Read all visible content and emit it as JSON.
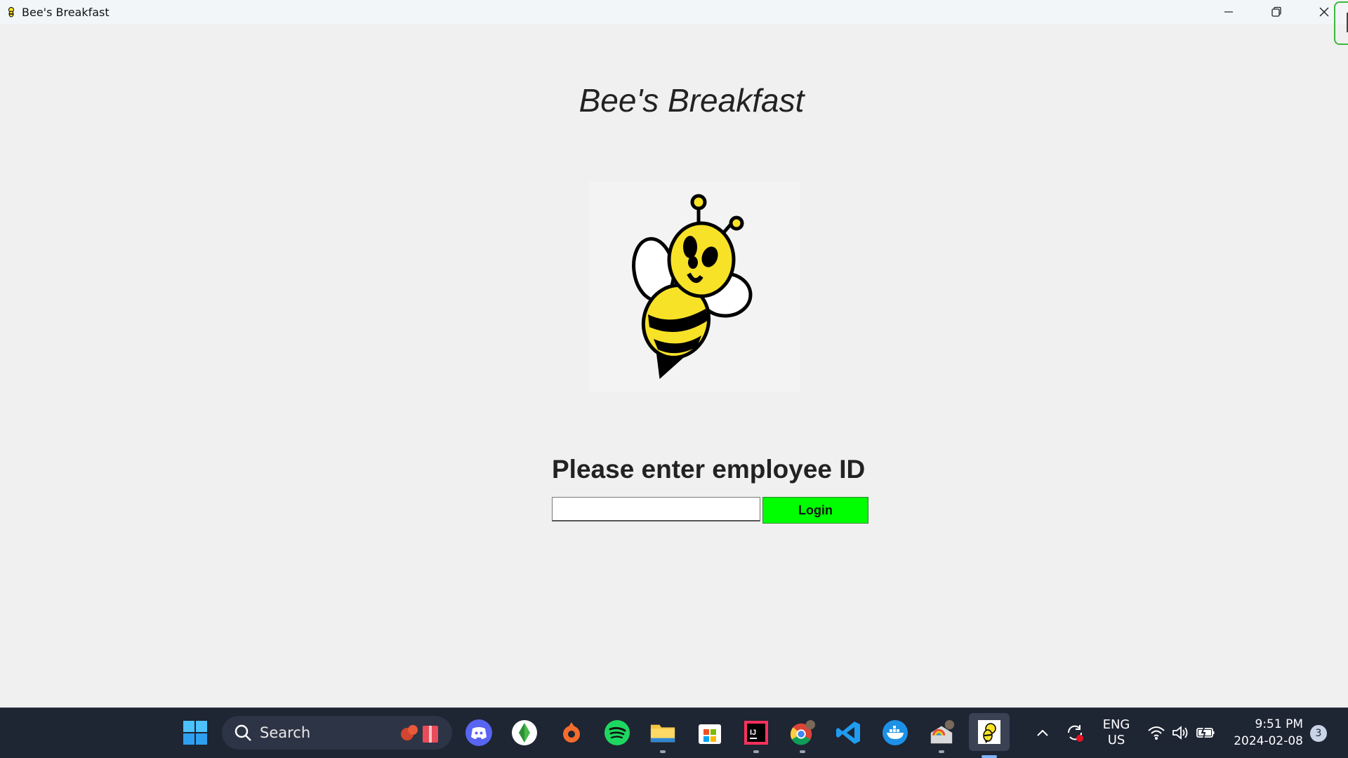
{
  "window": {
    "title": "Bee's Breakfast",
    "controls": [
      "minimize",
      "maximize",
      "close"
    ]
  },
  "main": {
    "heading": "Bee's Breakfast",
    "logo_icon": "bee-logo",
    "prompt": "Please enter employee ID",
    "employee_id": {
      "value": "",
      "placeholder": ""
    },
    "login_label": "Login",
    "login_color": "#00ff00"
  },
  "taskbar": {
    "search_label": "Search",
    "apps": [
      "start",
      "discord",
      "sims",
      "origin",
      "spotify",
      "file-explorer",
      "microsoft-store",
      "intellij-idea",
      "chrome",
      "vscode",
      "docker",
      "weather-app",
      "bees-breakfast"
    ],
    "tray": {
      "language": "ENG",
      "region": "US",
      "time": "9:51 PM",
      "date": "2024-02-08",
      "notifications": "3"
    }
  },
  "colors": {
    "background": "#f0f0f0",
    "taskbar": "#1e2533",
    "login_button": "#00ff00"
  }
}
